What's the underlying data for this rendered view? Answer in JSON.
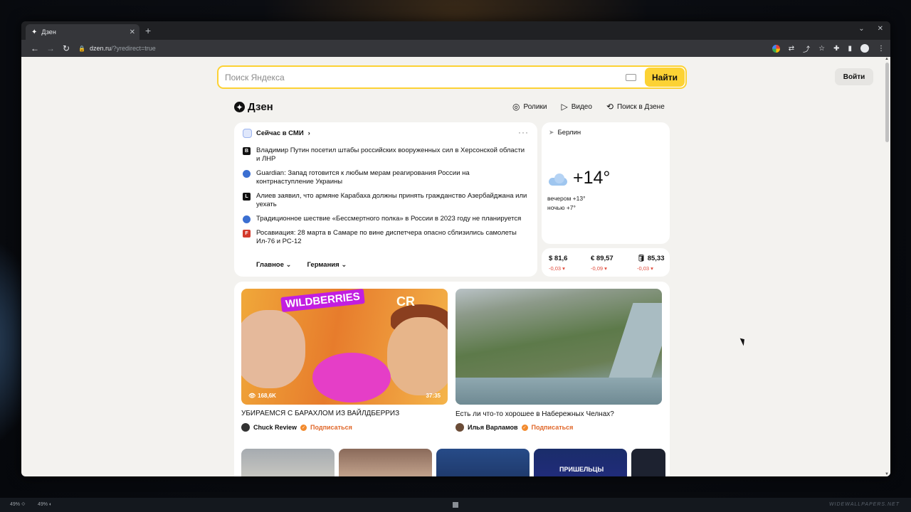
{
  "browser": {
    "tab_title": "Дзен",
    "url_host": "dzen.ru",
    "url_query": "/?yredirect=true"
  },
  "page": {
    "search_placeholder": "Поиск Яндекса",
    "search_button": "Найти",
    "login_button": "Войти",
    "logo_text": "Дзен",
    "nav": [
      "Ролики",
      "Видео",
      "Поиск в Дзене"
    ]
  },
  "news": {
    "title": "Сейчас в СМИ",
    "items": [
      {
        "text": "Владимир Путин посетил штабы российских вооруженных сил в Херсонской области и ЛНР"
      },
      {
        "text": "Guardian: Запад готовится к любым мерам реагирования России на контрнаступление Украины"
      },
      {
        "text": "Алиев заявил, что армяне Карабаха должны принять гражданство Азербайджана или уехать"
      },
      {
        "text": "Традиционное шествие «Бессмертного полка» в России в 2023 году не планируется"
      },
      {
        "text": "Росавиация: 28 марта в Самаре по вине диспетчера опасно сблизились самолеты Ил-76 и РС-12"
      }
    ],
    "tabs": [
      "Главное",
      "Германия"
    ]
  },
  "weather": {
    "city": "Берлин",
    "temp": "+14°",
    "evening": "вечером +13°",
    "night": "ночью +7°"
  },
  "rates": [
    {
      "value": "$ 81,6",
      "change": "-0,03 ▾"
    },
    {
      "value": "€ 89,57",
      "change": "-0,09 ▾"
    },
    {
      "value": "🛢 85,33",
      "change": "-0,03 ▾"
    }
  ],
  "feed": {
    "items": [
      {
        "views": "168,6K",
        "duration": "37:35",
        "title": "УБИРАЕМСЯ С БАРАХЛОМ ИЗ ВАЙЛДБЕРРИЗ",
        "author": "Chuck Review",
        "subscribe": "Подписаться",
        "badge_left": "WILDBERRIES",
        "badge_right": "CR"
      },
      {
        "title": "Есть ли что-то хорошее в Набережных Челнах?",
        "author": "Илья Варламов",
        "subscribe": "Подписаться"
      }
    ],
    "mini_label": "ПРИШЕЛЬЦЫ"
  },
  "taskbar": {
    "left1": "49% ⟐",
    "left2": "49% ◐",
    "watermark": "WIDEWALLPAPERS.NET"
  }
}
